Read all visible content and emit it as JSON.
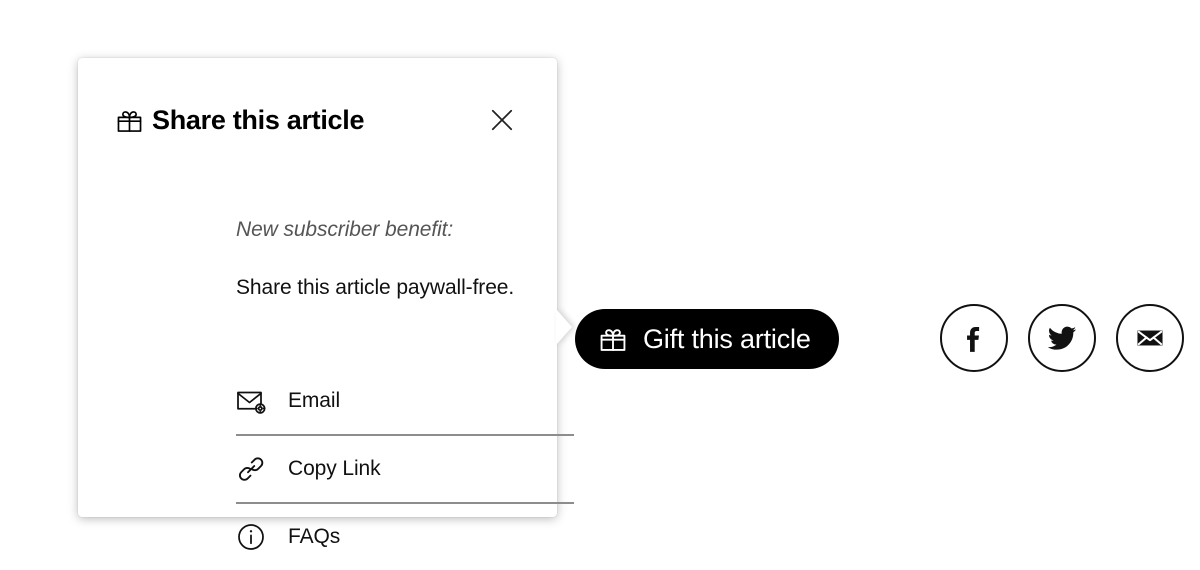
{
  "popover": {
    "title": "Share this article",
    "title_icon": "gift-icon",
    "close_icon": "close-icon",
    "benefit_label": "New subscriber benefit:",
    "benefit_description": "Share this article paywall-free.",
    "options": [
      {
        "label": "Email",
        "icon": "envelope-badge-icon"
      },
      {
        "label": "Copy Link",
        "icon": "link-chain-icon"
      },
      {
        "label": "FAQs",
        "icon": "info-circle-icon"
      }
    ]
  },
  "gift_button": {
    "label": "Gift this article",
    "icon": "gift-icon",
    "background_color": "#000000",
    "text_color": "#ffffff"
  },
  "social_buttons": [
    {
      "name": "facebook",
      "icon": "facebook-icon",
      "label": "f"
    },
    {
      "name": "twitter",
      "icon": "twitter-bird-icon",
      "label": ""
    },
    {
      "name": "email",
      "icon": "envelope-filled-icon",
      "label": ""
    }
  ],
  "colors": {
    "page_background": "#ffffff",
    "card_background": "#ffffff",
    "text_primary": "#111111",
    "text_muted": "#555555",
    "divider": "#8d8d8d",
    "accent": "#000000"
  }
}
